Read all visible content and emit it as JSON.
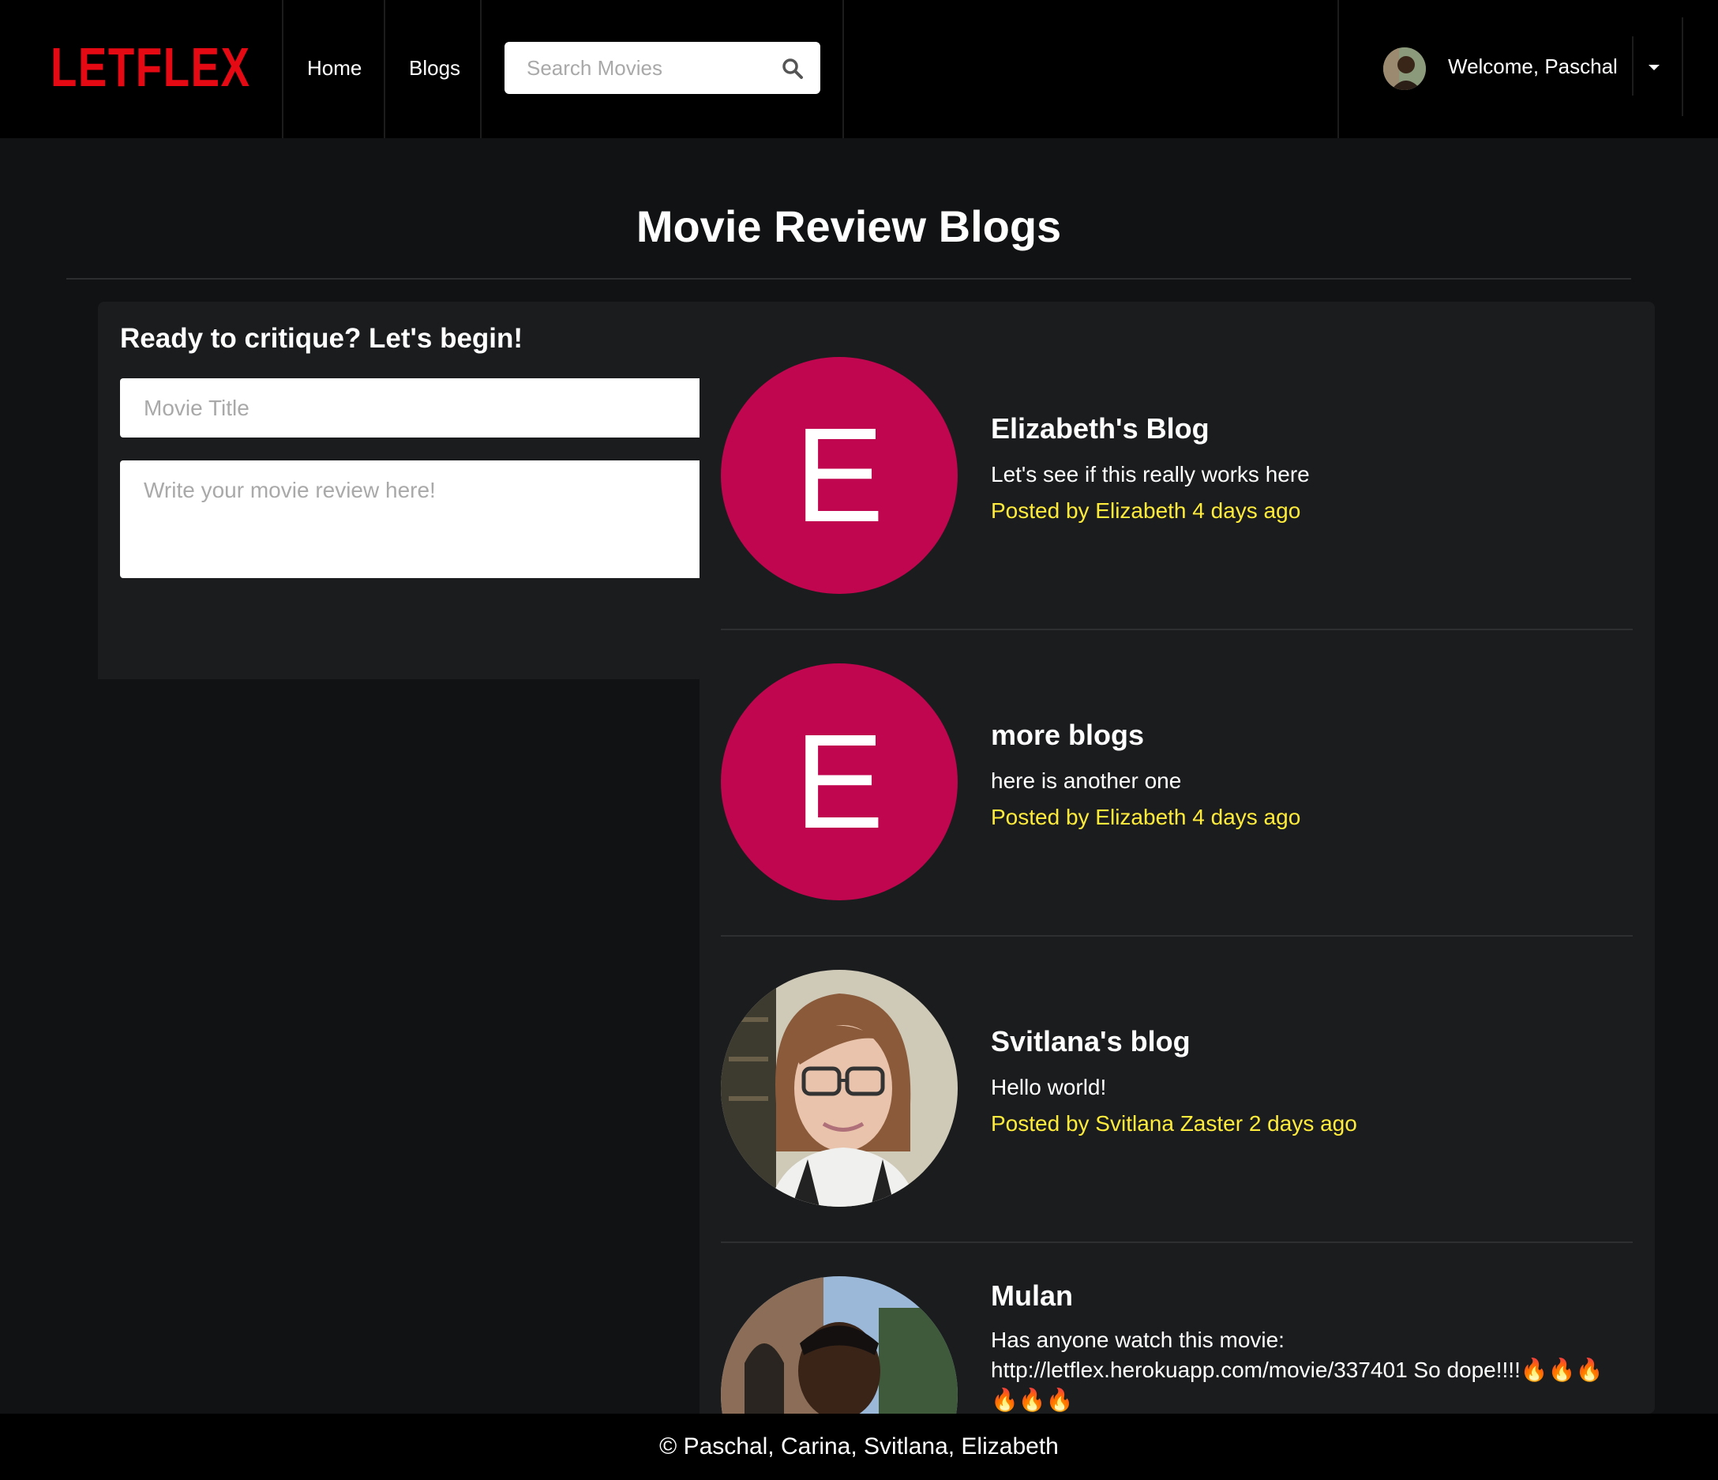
{
  "brand": {
    "name": "LETFLEX"
  },
  "nav": {
    "links": [
      {
        "label": "Home"
      },
      {
        "label": "Blogs"
      }
    ],
    "search": {
      "placeholder": "Search Movies",
      "value": ""
    },
    "user": {
      "welcome": "Welcome, Paschal"
    }
  },
  "page": {
    "title": "Movie Review Blogs"
  },
  "form": {
    "heading": "Ready to critique? Let's begin!",
    "title_placeholder": "Movie Title",
    "review_placeholder": "Write your movie review here!"
  },
  "blogs": [
    {
      "avatar_letter": "E",
      "title": "Elizabeth's Blog",
      "body": "Let's see if this really works here",
      "meta": "Posted by Elizabeth 4 days ago"
    },
    {
      "avatar_letter": "E",
      "title": "more blogs",
      "body": "here is another one",
      "meta": "Posted by Elizabeth 4 days ago"
    },
    {
      "avatar_letter": "",
      "title": "Svitlana's blog",
      "body": "Hello world!",
      "meta": "Posted by Svitlana Zaster 2 days ago"
    },
    {
      "avatar_letter": "",
      "title": "Mulan",
      "body": "Has anyone watch this movie: http://letflex.herokuapp.com/movie/337401 So dope!!!!🔥🔥🔥🔥🔥🔥",
      "meta": ""
    }
  ],
  "footer": {
    "text": "© Paschal, Carina, Svitlana, Elizabeth"
  },
  "colors": {
    "brand_red": "#e50914",
    "avatar_magenta": "#c0064f",
    "meta_yellow": "#ffeb3b",
    "panel_bg": "#1b1c1e",
    "page_bg": "#111213"
  }
}
